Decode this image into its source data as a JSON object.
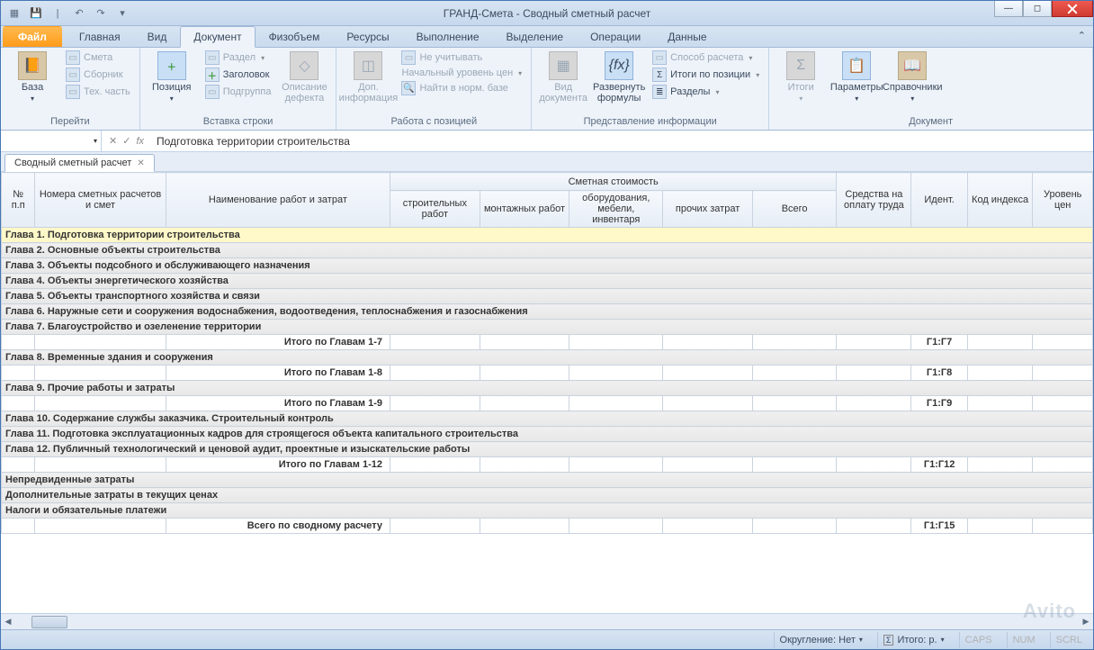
{
  "title": "ГРАНД-Смета - Сводный сметный расчет",
  "qat": [
    "save",
    "open",
    "undo",
    "redo",
    "dd"
  ],
  "win": {
    "min": "—",
    "max": "◻",
    "close": "✕"
  },
  "tabs": {
    "file": "Файл",
    "items": [
      "Главная",
      "Вид",
      "Документ",
      "Физобъем",
      "Ресурсы",
      "Выполнение",
      "Выделение",
      "Операции",
      "Данные"
    ],
    "active": "Документ"
  },
  "ribbon": {
    "g1": {
      "label": "Перейти",
      "big": "База",
      "small": [
        "Смета",
        "Сборник",
        "Тех. часть"
      ]
    },
    "g2": {
      "label": "Вставка строки",
      "big": "Позиция",
      "small": [
        "Раздел",
        "Заголовок",
        "Подгруппа"
      ]
    },
    "g3": {
      "label": "",
      "big": "Описание\nдефекта"
    },
    "g4": {
      "label": "",
      "big": "Доп.\nинформация"
    },
    "g5": {
      "label": "Работа с позицией",
      "small": [
        "Не учитывать",
        "Начальный уровень цен",
        "Найти в норм. базе"
      ]
    },
    "g6": {
      "label": "Представление информации",
      "big1": "Вид\nдокумента",
      "big2": "Развернуть\nформулы",
      "small": [
        "Способ расчета",
        "Итоги по позиции",
        "Разделы"
      ]
    },
    "g7": {
      "label": "Документ",
      "big1": "Итоги",
      "big2": "Параметры",
      "big3": "Справочники"
    }
  },
  "formula": {
    "fx": "fx",
    "value": "Подготовка территории строительства",
    "cancel": "✕",
    "ok": "✓"
  },
  "doctab": {
    "label": "Сводный сметный расчет",
    "close": "✕"
  },
  "columns": {
    "c1": "№\nп.п",
    "c2": "Номера сметных расчетов и смет",
    "c3": "Наименование работ и затрат",
    "group": "Сметная стоимость",
    "s1": "строительных работ",
    "s2": "монтажных работ",
    "s3": "оборудования, мебели, инвентаря",
    "s4": "прочих затрат",
    "s5": "Всего",
    "c4": "Средства на оплату труда",
    "c5": "Идент.",
    "c6": "Код индекса",
    "c7": "Уровень цен"
  },
  "rows": [
    {
      "t": "chapter",
      "sel": true,
      "text": "Глава 1. Подготовка территории строительства"
    },
    {
      "t": "chapter",
      "text": "Глава 2. Основные объекты строительства"
    },
    {
      "t": "chapter",
      "text": "Глава 3. Объекты подсобного и обслуживающего назначения"
    },
    {
      "t": "chapter",
      "text": "Глава 4. Объекты энергетического хозяйства"
    },
    {
      "t": "chapter",
      "text": "Глава 5. Объекты транспортного хозяйства и связи"
    },
    {
      "t": "chapter",
      "text": "Глава 6. Наружные сети и сооружения водоснабжения, водоотведения, теплоснабжения и газоснабжения"
    },
    {
      "t": "chapter",
      "text": "Глава 7. Благоустройство и озеленение территории"
    },
    {
      "t": "sub",
      "text": "Итого по Главам 1-7",
      "ident": "Г1:Г7"
    },
    {
      "t": "chapter",
      "text": "Глава 8. Временные здания и сооружения"
    },
    {
      "t": "sub",
      "text": "Итого по Главам 1-8",
      "ident": "Г1:Г8"
    },
    {
      "t": "chapter",
      "text": "Глава 9. Прочие работы и затраты"
    },
    {
      "t": "sub",
      "text": "Итого по Главам 1-9",
      "ident": "Г1:Г9"
    },
    {
      "t": "chapter",
      "text": "Глава 10. Содержание службы заказчика. Строительный контроль"
    },
    {
      "t": "chapter",
      "text": "Глава 11. Подготовка эксплуатационных кадров для строящегося объекта капитального строительства"
    },
    {
      "t": "chapter",
      "text": "Глава 12. Публичный технологический и ценовой аудит, проектные и изыскательские работы"
    },
    {
      "t": "sub",
      "text": "Итого по Главам 1-12",
      "ident": "Г1:Г12"
    },
    {
      "t": "extra",
      "text": "Непредвиденные затраты"
    },
    {
      "t": "extra",
      "text": "Дополнительные затраты в текущих ценах"
    },
    {
      "t": "extra",
      "text": "Налоги и обязательные платежи"
    },
    {
      "t": "sub",
      "text": "Всего по сводному расчету",
      "ident": "Г1:Г15"
    }
  ],
  "status": {
    "round": "Округление: Нет",
    "sum_lbl": "Итого: р.",
    "caps": "CAPS",
    "num": "NUM",
    "scrl": "SCRL"
  },
  "watermark": "Avito"
}
